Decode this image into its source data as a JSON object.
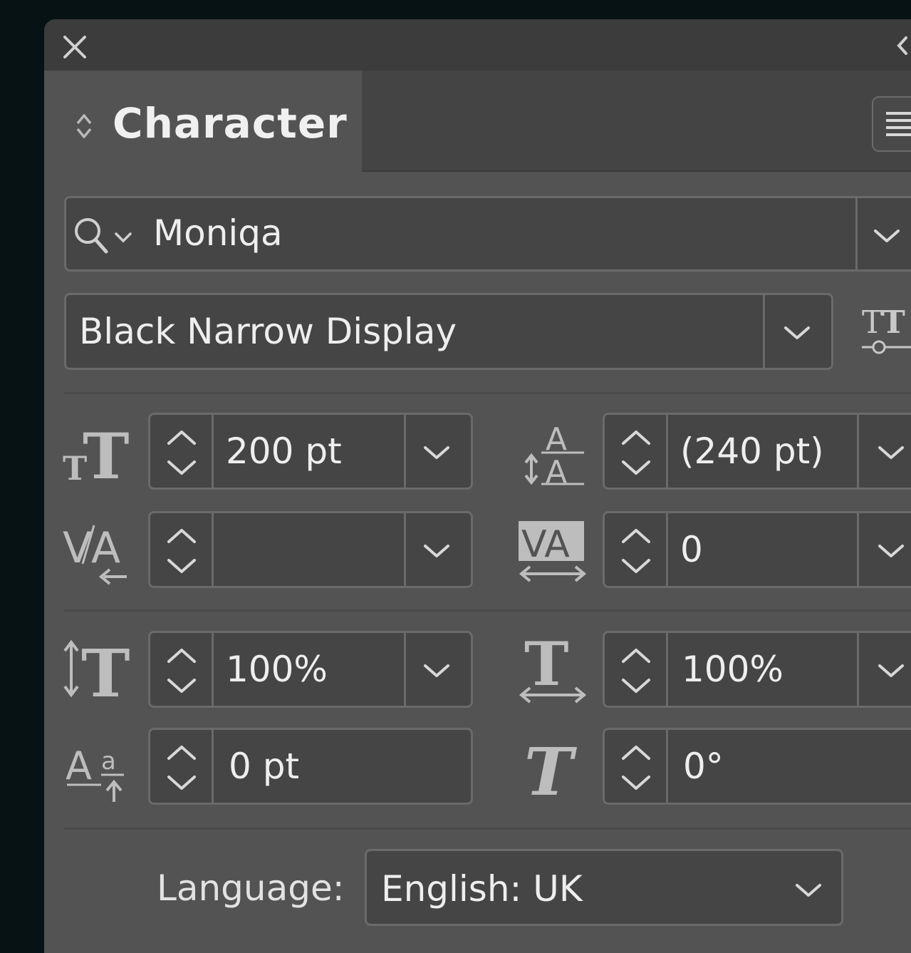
{
  "panel": {
    "tab_label": "Character",
    "font_family": "Moniqa",
    "font_style": "Black Narrow Display",
    "font_size": "200 pt",
    "leading": "(240 pt)",
    "kerning": "",
    "tracking": "0",
    "vertical_scale": "100%",
    "horizontal_scale": "100%",
    "baseline_shift": "0 pt",
    "skew": "0°",
    "language_label": "Language:",
    "language_value": "English: UK"
  },
  "icons": {
    "close": "close-icon",
    "collapse": "chevron-left-icon",
    "menu": "panel-menu-icon",
    "search": "search-icon",
    "font_size": "font-size-icon",
    "leading": "leading-icon",
    "kerning": "kerning-icon",
    "tracking": "tracking-icon",
    "vertical_scale": "vertical-scale-icon",
    "horizontal_scale": "horizontal-scale-icon",
    "baseline_shift": "baseline-shift-icon",
    "skew": "skew-icon"
  },
  "colors": {
    "background": "#061214",
    "panel": "#535353",
    "titlebar": "#3c3c3c",
    "field": "#454545",
    "text": "#eeeeee",
    "icon": "#c8c8c8"
  }
}
